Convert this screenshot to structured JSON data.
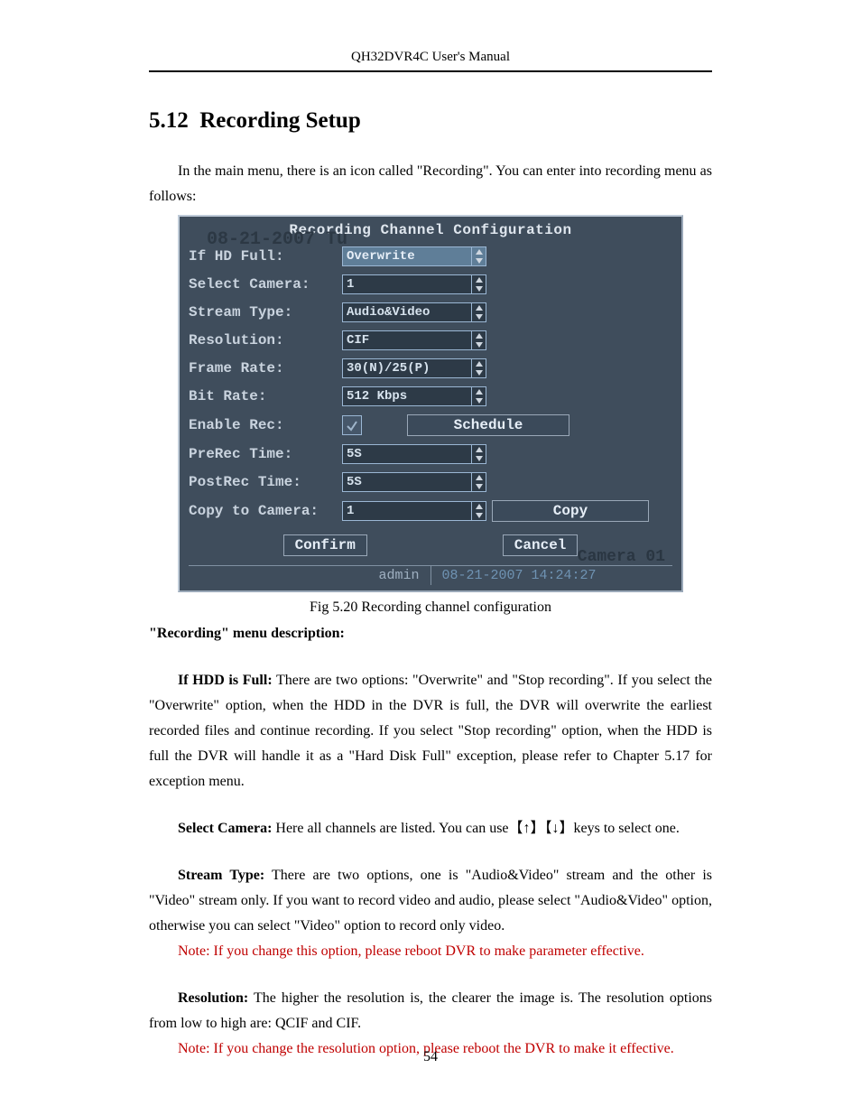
{
  "header": {
    "running": "QH32DVR4C User's Manual"
  },
  "section": {
    "number": "5.12",
    "title": "Recording Setup"
  },
  "intro": "In the main menu, there is an icon called \"Recording\". You can enter into recording menu as follows:",
  "dvr": {
    "title": "Recording Channel Configuration",
    "overlay_date": "08-21-2007 Tu",
    "rows": {
      "if_hd_full": {
        "label": "If HD Full:",
        "value": "Overwrite"
      },
      "select_camera": {
        "label": "Select Camera:",
        "value": "1"
      },
      "stream_type": {
        "label": "Stream Type:",
        "value": "Audio&Video"
      },
      "resolution": {
        "label": "Resolution:",
        "value": "CIF"
      },
      "frame_rate": {
        "label": "Frame Rate:",
        "value": "30(N)/25(P)"
      },
      "bit_rate": {
        "label": "Bit Rate:",
        "value": "512 Kbps"
      },
      "enable_rec": {
        "label": "Enable Rec:"
      },
      "prerec": {
        "label": "PreRec Time:",
        "value": "5S"
      },
      "postrec": {
        "label": "PostRec Time:",
        "value": "5S"
      },
      "copy_to": {
        "label": "Copy to Camera:",
        "value": "1"
      }
    },
    "buttons": {
      "schedule": "Schedule",
      "copy": "Copy",
      "confirm": "Confirm",
      "cancel": "Cancel"
    },
    "footer": {
      "user": "admin",
      "datetime": "08-21-2007 14:24:27",
      "camera_tag": "Camera 01"
    }
  },
  "fig_caption": "Fig 5.20 Recording channel configuration",
  "desc_heading": "\"Recording\" menu description:",
  "paragraphs": {
    "hdd_full_label": "If HDD is Full:",
    "hdd_full_text": " There are two options: \"Overwrite\" and \"Stop recording\". If you select the \"Overwrite\" option, when the HDD in the DVR is full, the DVR will overwrite the earliest recorded files and continue recording. If you select \"Stop recording\" option, when the HDD is full the DVR will handle it as a \"Hard Disk Full\" exception, please refer to Chapter 5.17 for exception menu.",
    "select_camera_label": "Select Camera:",
    "select_camera_text": " Here all channels are listed. You can use【↑】【↓】keys to select one.",
    "stream_type_label": "Stream Type:",
    "stream_type_text": " There are two options, one is \"Audio&Video\" stream and the other is \"Video\" stream only. If you want to record video and audio, please select \"Audio&Video\" option, otherwise you can select \"Video\" option to record only video.",
    "stream_type_note": "Note: If you change this option, please reboot DVR to make parameter effective.",
    "resolution_label": "Resolution:",
    "resolution_text": " The higher the resolution is, the clearer the image is. The resolution options from low to high are: QCIF and CIF.",
    "resolution_note": "Note: If you change the resolution option, please reboot the DVR to make it effective."
  },
  "page_number": "54"
}
